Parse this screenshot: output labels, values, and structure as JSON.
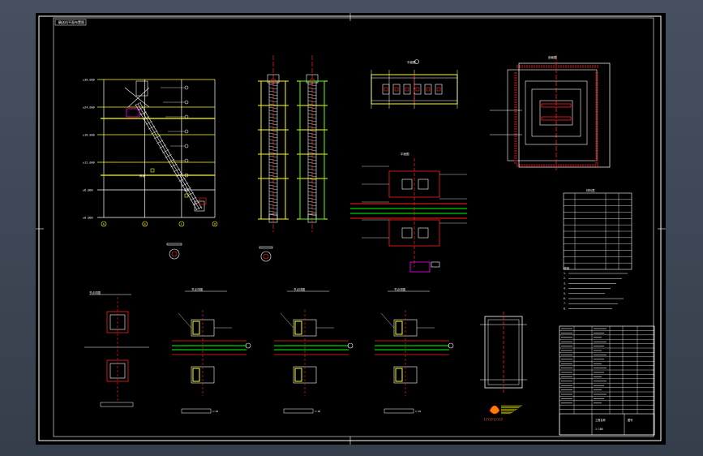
{
  "viewer": {
    "background": "#000000",
    "frame_color": "#ffffff",
    "colors": {
      "white": "#ffffff",
      "yellow": "#ffff00",
      "red": "#ff2020",
      "green": "#00ff00",
      "magenta": "#ff00ff",
      "cyan": "#00ffff",
      "orange": "#ff8000"
    }
  },
  "drawing": {
    "sheet_tag": "輸送机平面布置图",
    "slope_label": "斜坡",
    "elevation_labels": [
      "±0.000",
      "±6.000",
      "±12.000",
      "±18.000",
      "±24.000",
      "±30.000"
    ],
    "axis_labels": [
      "A",
      "B",
      "C",
      "D"
    ],
    "plan_title": "平面图",
    "section_title": "剖面图",
    "detail_titles": [
      "节点详图",
      "节点详图",
      "节点详图",
      "节点详图"
    ],
    "detail_scales": [
      "1:20",
      "1:20",
      "1:20",
      "1:20"
    ],
    "notes_title": "说明",
    "logo_text": "??????????",
    "title_block": {
      "project": "工程名称",
      "drawing_no": "图号",
      "scale": "1:100"
    }
  },
  "legend_table": {
    "title": "材料表",
    "rows": 12
  },
  "notes": [
    "1.",
    "2.",
    "3.",
    "4.",
    "5.",
    "6.",
    "7.",
    "8."
  ]
}
